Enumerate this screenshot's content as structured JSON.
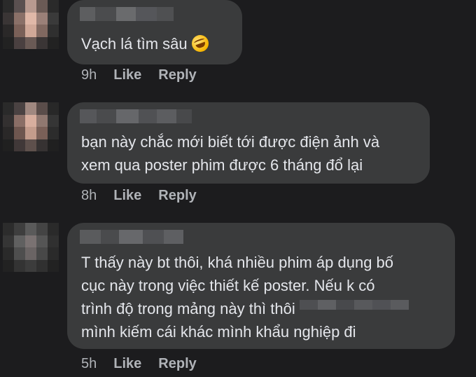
{
  "comments": [
    {
      "text_lines": [
        "Vạch lá tìm sâu"
      ],
      "emoji": "rolling-on-floor-laughing",
      "time": "9h",
      "like": "Like",
      "reply": "Reply"
    },
    {
      "text_lines": [
        "bạn này chắc mới biết tới được điện ảnh và",
        "xem qua poster phim được 6 tháng đổ lại"
      ],
      "time": "8h",
      "like": "Like",
      "reply": "Reply"
    },
    {
      "text_lines": [
        "T thấy này bt thôi, khá nhiều phim áp dụng bố",
        "cục này trong việc thiết kế poster. Nếu k có",
        "trình độ trong mảng này thì thôi",
        "mình kiếm cái khác mình khẩu nghiệp đi"
      ],
      "time": "5h",
      "like": "Like",
      "reply": "Reply"
    }
  ]
}
